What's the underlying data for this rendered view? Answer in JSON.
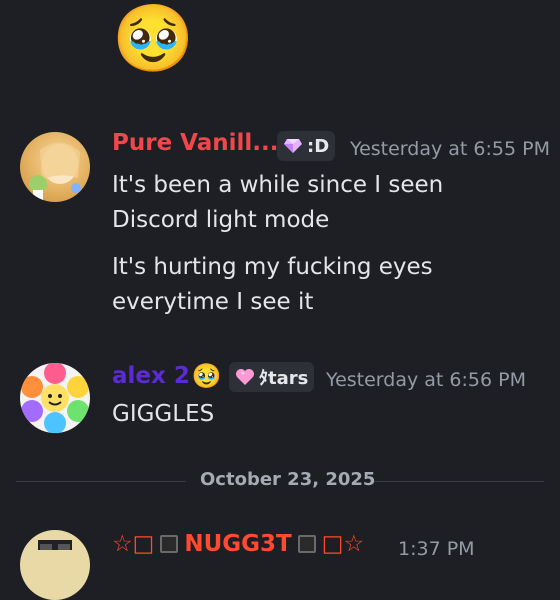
{
  "top_emoji": "🥹",
  "messages": [
    {
      "username": "Pure Vanill...",
      "username_color": "#f0484a",
      "tag_icon": "gem-icon",
      "tag_text": ":D",
      "timestamp": "Yesterday at 6:55 PM",
      "lines": [
        "It's been a while since I seen",
        "Discord light mode",
        "It's hurting my fucking eyes",
        "everytime I see it"
      ]
    },
    {
      "username": "alex 2",
      "username_emoji": "🥹",
      "username_color": "#5b2bd6",
      "tag_icon": "heart-icon",
      "tag_text": "ﾀtars",
      "timestamp": "Yesterday at 6:56 PM",
      "lines": [
        "GIGGLES"
      ]
    },
    {
      "username_prefix": "☆□",
      "username": "NUGG3T",
      "username_suffix": "□☆",
      "username_color": "#ff4a2e",
      "timestamp": "1:37 PM"
    }
  ],
  "date_divider": "October 23, 2025"
}
